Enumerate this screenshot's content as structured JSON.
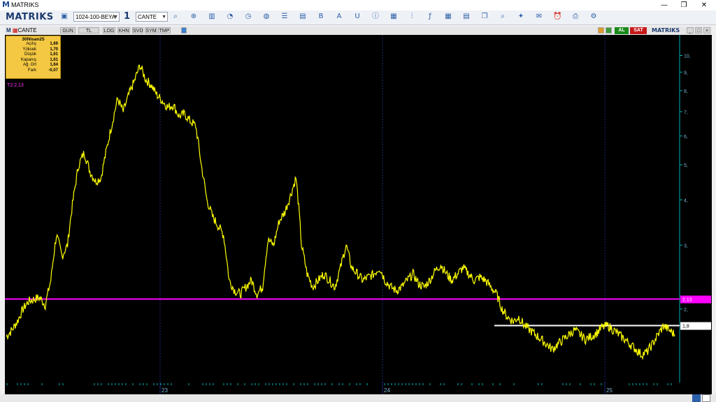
{
  "window": {
    "title": "MATRIKS",
    "controls": {
      "minimize": "—",
      "maximize": "❐",
      "close": "✕"
    }
  },
  "toolbar": {
    "logo": "MATRIKS",
    "layout_select": "1024-100-BEYA",
    "period": "1",
    "symbol_select": "CANTE",
    "icons": [
      "save-icon",
      "search-icon",
      "zoom-icon",
      "bar-chart-icon",
      "pie-chart-icon",
      "clock-icon",
      "globe-icon",
      "list-icon",
      "document-icon",
      "bold-icon",
      "text-color-icon",
      "underline-icon",
      "info-icon",
      "news-icon",
      "indicator-icon",
      "function-icon",
      "grid-icon",
      "table-icon",
      "copy-icon",
      "search-icon",
      "twitter-icon",
      "mail-icon",
      "alarm-icon",
      "print-icon",
      "settings-icon"
    ]
  },
  "chartbar": {
    "symbol": "CANTE",
    "period_buttons": [
      "GUN",
      "TL",
      "LOG",
      "KHN",
      "SVD",
      "SYM",
      "TMP"
    ],
    "buy_label": "AL",
    "sell_label": "SAT",
    "brand": "MATRIKS"
  },
  "infobox": {
    "date": "30Nisan25",
    "rows": [
      {
        "label": "Açılış",
        "value": "1,69"
      },
      {
        "label": "Yüksek",
        "value": "1,70"
      },
      {
        "label": "Düşük",
        "value": "1,61"
      },
      {
        "label": "Kapanış",
        "value": "1,61"
      },
      {
        "label": "Ağ. Ort",
        "value": "1,64"
      },
      {
        "label": "Fark",
        "value": "-0,07"
      }
    ]
  },
  "chart_data": {
    "type": "line",
    "ytick_labels": [
      "10,",
      "9,",
      "8,",
      "7,",
      "6,",
      "5,",
      "4,",
      "3,",
      "2,"
    ],
    "yticks": [
      10,
      9,
      8,
      7,
      6,
      5,
      4,
      3,
      2
    ],
    "ylim": [
      1.3,
      11
    ],
    "log_scale": true,
    "xtick_labels": [
      "23",
      "24",
      "25"
    ],
    "horizontal_lines": [
      {
        "label": "2,13",
        "value": 2.13,
        "color": "#ff00ff"
      },
      {
        "label": "1,8",
        "value": 1.8,
        "color": "#ffffff"
      }
    ],
    "annotation": "T2:2,13",
    "series": [
      {
        "color": "#ffff00",
        "values": [
          1.68,
          1.75,
          1.85,
          2.0,
          2.1,
          2.13,
          2.15,
          2.05,
          2.4,
          3.2,
          2.8,
          3.0,
          4.0,
          5.0,
          5.4,
          4.8,
          4.5,
          4.6,
          5.5,
          6.5,
          7.6,
          7.0,
          7.8,
          8.5,
          9.4,
          8.6,
          8.3,
          7.8,
          7.5,
          7.2,
          7.3,
          6.8,
          6.9,
          6.6,
          6.4,
          5.0,
          4.0,
          3.6,
          3.4,
          3.2,
          2.4,
          2.25,
          2.2,
          2.3,
          2.4,
          2.2,
          2.3,
          3.1,
          3.0,
          3.5,
          3.7,
          4.1,
          4.6,
          3.0,
          2.5,
          2.3,
          2.4,
          2.5,
          2.4,
          2.3,
          2.6,
          3.0,
          2.6,
          2.5,
          2.4,
          2.45,
          2.5,
          2.6,
          2.4,
          2.3,
          2.25,
          2.3,
          2.4,
          2.5,
          2.35,
          2.3,
          2.4,
          2.55,
          2.65,
          2.5,
          2.4,
          2.5,
          2.6,
          2.5,
          2.4,
          2.45,
          2.4,
          2.3,
          2.2,
          2.0,
          1.9,
          1.85,
          1.9,
          1.8,
          1.75,
          1.7,
          1.65,
          1.6,
          1.55,
          1.6,
          1.65,
          1.7,
          1.75,
          1.7,
          1.65,
          1.68,
          1.72,
          1.78,
          1.8,
          1.75,
          1.7,
          1.65,
          1.6,
          1.55,
          1.5,
          1.52,
          1.6,
          1.7,
          1.8,
          1.75,
          1.7
        ]
      }
    ]
  },
  "colors": {
    "chart_bg": "#000000",
    "price_line": "#ffff00",
    "support_line": "#ff00ff",
    "level_line": "#ffffff",
    "axis": "#00b3b3"
  }
}
